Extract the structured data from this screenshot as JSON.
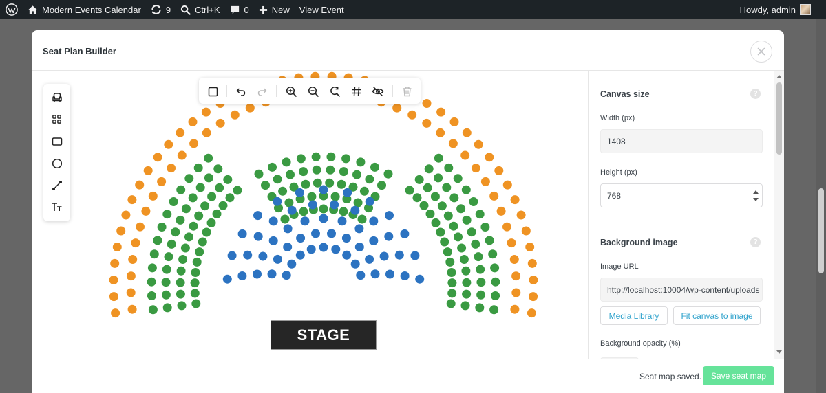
{
  "adminbar": {
    "site_name": "Modern Events Calendar",
    "updates_count": "9",
    "search_shortcut": "Ctrl+K",
    "comments_count": "0",
    "new_label": "New",
    "view_event_label": "View Event",
    "howdy": "Howdy, admin"
  },
  "modal": {
    "title": "Seat Plan Builder"
  },
  "canvas": {
    "stage_label": "STAGE",
    "seat_colors": {
      "outer": "#ef9323",
      "side": "#3a9a42",
      "center": "#3a9a42",
      "front": "#2c73c1"
    }
  },
  "panel": {
    "canvas_size_title": "Canvas size",
    "width_label": "Width (px)",
    "width_value": "1408",
    "height_label": "Height (px)",
    "height_value": "768",
    "bg_image_title": "Background image",
    "image_url_label": "Image URL",
    "image_url_value": "http://localhost:10004/wp-content/uploads",
    "media_library_label": "Media Library",
    "fit_canvas_label": "Fit canvas to image",
    "bg_opacity_label": "Background opacity (%)",
    "help_glyph": "?"
  },
  "footer": {
    "status": "Seat map saved.",
    "save_label": "Save seat map"
  }
}
